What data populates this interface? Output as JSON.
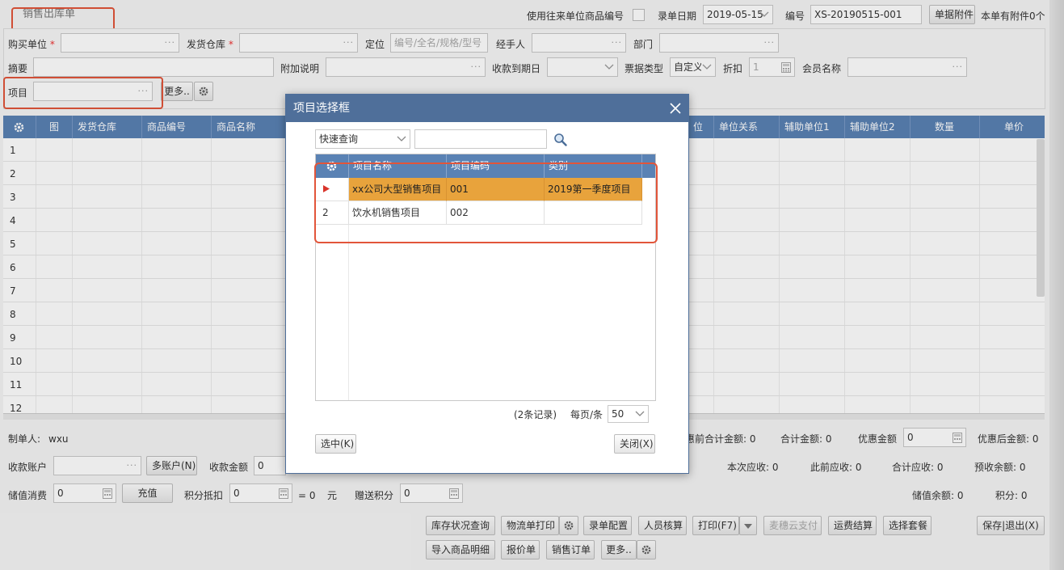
{
  "form": {
    "title": "销售出库单",
    "use_partner_code_label": "使用往来单位商品编号",
    "entry_date_label": "录单日期",
    "entry_date_value": "2019-05-15",
    "doc_no_label": "编号",
    "doc_no_value": "XS-20190515-001",
    "attachment_button": "单据附件",
    "attachment_count": "本单有附件0个",
    "buyer_label": "购买单位",
    "warehouse_label": "发货仓库",
    "locate_label": "定位",
    "locate_placeholder": "编号/全名/规格/型号",
    "handler_label": "经手人",
    "dept_label": "部门",
    "summary_label": "摘要",
    "extra_label": "附加说明",
    "due_label": "收款到期日",
    "bill_type_label": "票据类型",
    "bill_type_value": "自定义",
    "discount_label": "折扣",
    "discount_value": "1",
    "member_label": "会员名称",
    "project_label": "项目",
    "more_button": "更多..",
    "required_mark": "*"
  },
  "grid": {
    "columns": [
      "图",
      "发货仓库",
      "商品编号",
      "商品名称",
      "位",
      "单位关系",
      "辅助单位1",
      "辅助单位2",
      "数量",
      "单价"
    ],
    "rows": [
      "1",
      "2",
      "3",
      "4",
      "5",
      "6",
      "7",
      "8",
      "9",
      "10",
      "11",
      "12"
    ]
  },
  "footer": {
    "maker_label": "制单人:",
    "maker_value": "wxu",
    "account_label": "收款账户",
    "multi_account_button": "多账户(N)",
    "amount_label": "收款金额",
    "amount_value": "0",
    "stored_label": "储值消费",
    "stored_value": "0",
    "recharge_button": "充值",
    "points_label": "积分抵扣",
    "points_value": "0",
    "equals_text": "= 0",
    "yuan_text": "元",
    "gift_points_label": "赠送积分",
    "gift_points_value": "0",
    "pre_total_text": "优惠前合计金额: 0",
    "total_text": "合计金额: 0",
    "discount_amt_label": "优惠金额",
    "discount_amt_value": "0",
    "after_total_text": "优惠后金额: 0",
    "receivable_text": "本次应收: 0",
    "prev_receivable_text": "此前应收: 0",
    "sum_receivable_text": "合计应收: 0",
    "prepaid_text": "预收余额: 0",
    "stored_balance_text": "储值余额: 0",
    "points_total_text": "积分: 0"
  },
  "actions": {
    "row1": [
      "库存状况查询",
      "物流单打印",
      "录单配置",
      "人员核算",
      "打印(F7)",
      "麦穗云支付",
      "运费结算",
      "选择套餐",
      "保存|退出(X)"
    ],
    "row2": [
      "导入商品明细",
      "报价单",
      "销售订单",
      "更多.."
    ]
  },
  "dialog": {
    "title": "项目选择框",
    "search_mode": "快速查询",
    "search_value": "",
    "columns": [
      "项目名称",
      "项目编码",
      "类别"
    ],
    "rows": [
      {
        "no": "",
        "name": "xx公司大型销售项目",
        "code": "001",
        "category": "2019第一季度项目"
      },
      {
        "no": "2",
        "name": "饮水机销售项目",
        "code": "002",
        "category": ""
      }
    ],
    "records_text": "(2条记录)",
    "per_page_label": "每页/条",
    "per_page_value": "50",
    "select_button": "选中(K)",
    "close_button": "关闭(X)"
  }
}
